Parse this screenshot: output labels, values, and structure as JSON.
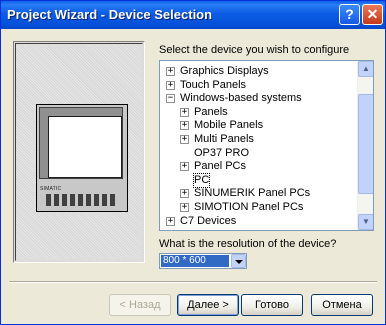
{
  "window": {
    "title": "Project Wizard - Device Selection",
    "help_glyph": "?",
    "close_glyph": "✕"
  },
  "illustration": {
    "brand": "SIMATIC"
  },
  "prompt": "Select the device you wish to configure",
  "tree": {
    "nodes": [
      {
        "label": "Graphics Displays",
        "level": 0,
        "expander": "+"
      },
      {
        "label": "Touch Panels",
        "level": 0,
        "expander": "+"
      },
      {
        "label": "Windows-based systems",
        "level": 0,
        "expander": "−"
      },
      {
        "label": "Panels",
        "level": 1,
        "expander": "+"
      },
      {
        "label": "Mobile Panels",
        "level": 1,
        "expander": "+"
      },
      {
        "label": "Multi Panels",
        "level": 1,
        "expander": "+"
      },
      {
        "label": "OP37 PRO",
        "level": 1,
        "expander": ""
      },
      {
        "label": "Panel PCs",
        "level": 1,
        "expander": "+"
      },
      {
        "label": "PC",
        "level": 1,
        "expander": "",
        "selected": true
      },
      {
        "label": "SINUMERIK Panel PCs",
        "level": 1,
        "expander": "+"
      },
      {
        "label": "SIMOTION Panel PCs",
        "level": 1,
        "expander": "+"
      },
      {
        "label": "C7 Devices",
        "level": 0,
        "expander": "+"
      }
    ]
  },
  "resolution": {
    "label": "What is the resolution of the device?",
    "value": "800 * 600"
  },
  "buttons": {
    "back": "< Назад",
    "next": "Далее >",
    "finish": "Готово",
    "cancel": "Отмена"
  }
}
